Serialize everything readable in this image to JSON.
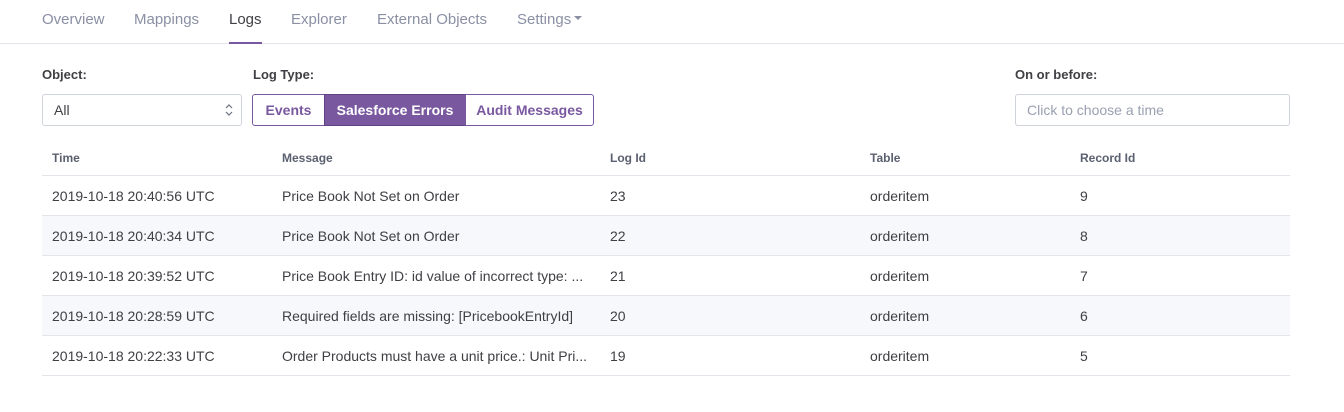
{
  "tabs": [
    {
      "label": "Overview"
    },
    {
      "label": "Mappings"
    },
    {
      "label": "Logs"
    },
    {
      "label": "Explorer"
    },
    {
      "label": "External Objects"
    },
    {
      "label": "Settings"
    }
  ],
  "active_tab": "Logs",
  "filters": {
    "object_label": "Object:",
    "object_value": "All",
    "log_type_label": "Log Type:",
    "log_types": [
      "Events",
      "Salesforce Errors",
      "Audit Messages"
    ],
    "selected_log_type": "Salesforce Errors",
    "date_label": "On or before:",
    "date_placeholder": "Click to choose a time"
  },
  "table": {
    "columns": [
      "Time",
      "Message",
      "Log Id",
      "Table",
      "Record Id"
    ],
    "rows": [
      {
        "time": "2019-10-18 20:40:56 UTC",
        "message": "Price Book Not Set on Order",
        "log_id": "23",
        "table": "orderitem",
        "record_id": "9"
      },
      {
        "time": "2019-10-18 20:40:34 UTC",
        "message": "Price Book Not Set on Order",
        "log_id": "22",
        "table": "orderitem",
        "record_id": "8"
      },
      {
        "time": "2019-10-18 20:39:52 UTC",
        "message": "Price Book Entry ID: id value of incorrect type: ...",
        "log_id": "21",
        "table": "orderitem",
        "record_id": "7"
      },
      {
        "time": "2019-10-18 20:28:59 UTC",
        "message": "Required fields are missing: [PricebookEntryId]",
        "log_id": "20",
        "table": "orderitem",
        "record_id": "6"
      },
      {
        "time": "2019-10-18 20:22:33 UTC",
        "message": "Order Products must have a unit price.: Unit Pri...",
        "log_id": "19",
        "table": "orderitem",
        "record_id": "5"
      }
    ]
  },
  "colors": {
    "accent": "#79589f",
    "border": "#e3e5ea",
    "muted_text": "#8a90a4"
  }
}
